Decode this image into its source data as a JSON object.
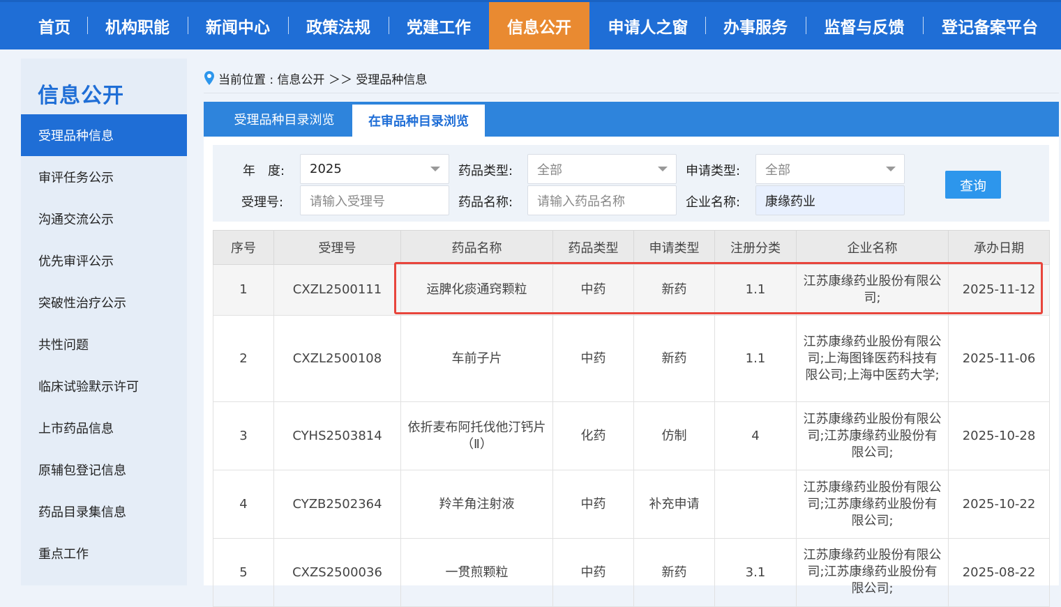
{
  "nav": {
    "items": [
      "首页",
      "机构职能",
      "新闻中心",
      "政策法规",
      "党建工作",
      "信息公开",
      "申请人之窗",
      "办事服务",
      "监督与反馈",
      "登记备案平台"
    ],
    "active": "信息公开",
    "colors": {
      "bar": "#1f6ed6",
      "active": "#e98a31"
    }
  },
  "sidebar": {
    "title": "信息公开",
    "items": [
      "受理品种信息",
      "审评任务公示",
      "沟通交流公示",
      "优先审评公示",
      "突破性治疗公示",
      "共性问题",
      "临床试验默示许可",
      "上市药品信息",
      "原辅包登记信息",
      "药品目录集信息",
      "重点工作"
    ],
    "active": "受理品种信息"
  },
  "breadcrumb": {
    "text": "当前位置 : 信息公开 ＞＞ 受理品种信息",
    "icon": "location-pin-icon"
  },
  "tabs": {
    "items": [
      "受理品种目录浏览",
      "在审品种目录浏览"
    ],
    "active": "在审品种目录浏览"
  },
  "filters": {
    "year_label": "年　度:",
    "year_value": "2025",
    "drug_type_label": "药品类型:",
    "drug_type_value": "全部",
    "apply_type_label": "申请类型:",
    "apply_type_value": "全部",
    "accept_no_label": "受理号:",
    "accept_no_placeholder": "请输入受理号",
    "drug_name_label": "药品名称:",
    "drug_name_placeholder": "请输入药品名称",
    "company_label": "企业名称:",
    "company_value": "康缘药业",
    "query_label": "查询"
  },
  "table": {
    "headers": [
      "序号",
      "受理号",
      "药品名称",
      "药品类型",
      "申请类型",
      "注册分类",
      "企业名称",
      "承办日期"
    ],
    "rows": [
      [
        "1",
        "CXZL2500111",
        "运脾化痰通窍颗粒",
        "中药",
        "新药",
        "1.1",
        "江苏康缘药业股份有限公司;",
        "2025-11-12"
      ],
      [
        "2",
        "CXZL2500108",
        "车前子片",
        "中药",
        "新药",
        "1.1",
        "江苏康缘药业股份有限公司;上海图锋医药科技有限公司;上海中医药大学;",
        "2025-11-06"
      ],
      [
        "3",
        "CYHS2503814",
        "依折麦布阿托伐他汀钙片（Ⅱ）",
        "化药",
        "仿制",
        "4",
        "江苏康缘药业股份有限公司;江苏康缘药业股份有限公司;",
        "2025-10-28"
      ],
      [
        "4",
        "CYZB2502364",
        "羚羊角注射液",
        "中药",
        "补充申请",
        "",
        "江苏康缘药业股份有限公司;江苏康缘药业股份有限公司;",
        "2025-10-22"
      ],
      [
        "5",
        "CXZS2500036",
        "一贯煎颗粒",
        "中药",
        "新药",
        "3.1",
        "江苏康缘药业股份有限公司;江苏康缘药业股份有限公司;",
        "2025-08-22"
      ]
    ],
    "highlight_color": "#e8453c"
  }
}
